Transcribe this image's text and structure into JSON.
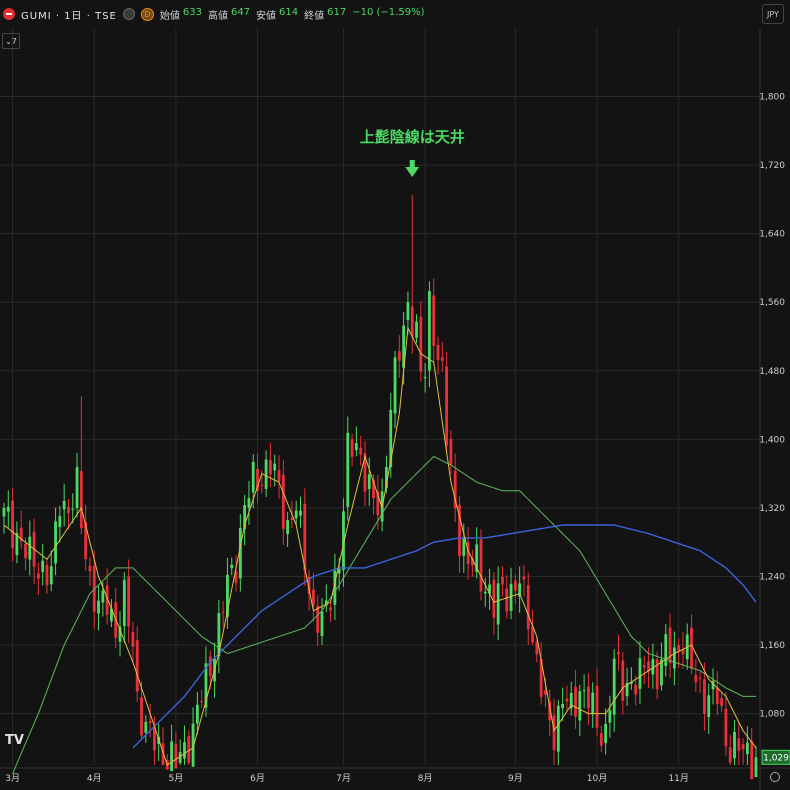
{
  "header": {
    "symbol": "GUMI · 1日 · TSE",
    "ohlc": [
      {
        "k": "始値",
        "v": "633"
      },
      {
        "k": "高値",
        "v": "647"
      },
      {
        "k": "安値",
        "v": "614"
      },
      {
        "k": "終値",
        "v": "617"
      },
      {
        "k": "",
        "v": "−10 (−1.59%)"
      }
    ],
    "currency": "JPY",
    "indicator_count": "7",
    "orange_badge": "D"
  },
  "colors": {
    "background": "#131313",
    "up": "#4cd964",
    "down": "#e8303a",
    "ma_short": "#e0c040",
    "ma_mid": "#5dbb5d",
    "ma_long": "#3a64d8",
    "annotation": "#4cd964"
  },
  "chart_data": {
    "type": "candlestick",
    "title": "",
    "annotation": "上髭陰線は天井",
    "y_ticks": [
      "1,800",
      "1,720",
      "1,640",
      "1,560",
      "1,480",
      "1,400",
      "1,320",
      "1,240",
      "1,160",
      "1,080"
    ],
    "ylim": [
      1020,
      1880
    ],
    "last_price_label": "1,029",
    "months": [
      {
        "label": "3月",
        "t": 2
      },
      {
        "label": "4月",
        "t": 21
      },
      {
        "label": "5月",
        "t": 40
      },
      {
        "label": "6月",
        "t": 59
      },
      {
        "label": "7月",
        "t": 79
      },
      {
        "label": "8月",
        "t": 98
      },
      {
        "label": "9月",
        "t": 119
      },
      {
        "label": "10月",
        "t": 138
      },
      {
        "label": "11月",
        "t": 157
      }
    ],
    "n_days": 176,
    "close_keyframes": [
      [
        0,
        1310
      ],
      [
        3,
        1290
      ],
      [
        6,
        1260
      ],
      [
        9,
        1250
      ],
      [
        11,
        1240
      ],
      [
        13,
        1330
      ],
      [
        15,
        1320
      ],
      [
        17,
        1340
      ],
      [
        18,
        1300
      ],
      [
        20,
        1240
      ],
      [
        22,
        1200
      ],
      [
        24,
        1210
      ],
      [
        26,
        1180
      ],
      [
        28,
        1210
      ],
      [
        30,
        1160
      ],
      [
        31,
        1100
      ],
      [
        33,
        1060
      ],
      [
        36,
        1040
      ],
      [
        38,
        1030
      ],
      [
        40,
        1020
      ],
      [
        42,
        1040
      ],
      [
        44,
        1060
      ],
      [
        46,
        1100
      ],
      [
        48,
        1140
      ],
      [
        50,
        1180
      ],
      [
        52,
        1230
      ],
      [
        54,
        1260
      ],
      [
        56,
        1320
      ],
      [
        58,
        1350
      ],
      [
        60,
        1360
      ],
      [
        62,
        1370
      ],
      [
        64,
        1340
      ],
      [
        66,
        1300
      ],
      [
        68,
        1320
      ],
      [
        70,
        1260
      ],
      [
        72,
        1200
      ],
      [
        74,
        1180
      ],
      [
        76,
        1220
      ],
      [
        78,
        1260
      ],
      [
        80,
        1380
      ],
      [
        82,
        1400
      ],
      [
        84,
        1360
      ],
      [
        86,
        1320
      ],
      [
        88,
        1330
      ],
      [
        90,
        1440
      ],
      [
        92,
        1500
      ],
      [
        94,
        1560
      ],
      [
        95,
        1580
      ],
      [
        96,
        1520
      ],
      [
        97,
        1470
      ],
      [
        98,
        1480
      ],
      [
        99,
        1560
      ],
      [
        100,
        1530
      ],
      [
        101,
        1500
      ],
      [
        102,
        1470
      ],
      [
        103,
        1400
      ],
      [
        104,
        1360
      ],
      [
        105,
        1320
      ],
      [
        106,
        1290
      ],
      [
        108,
        1250
      ],
      [
        110,
        1260
      ],
      [
        112,
        1230
      ],
      [
        114,
        1200
      ],
      [
        116,
        1230
      ],
      [
        118,
        1220
      ],
      [
        120,
        1230
      ],
      [
        122,
        1200
      ],
      [
        124,
        1140
      ],
      [
        126,
        1080
      ],
      [
        128,
        1060
      ],
      [
        130,
        1100
      ],
      [
        132,
        1080
      ],
      [
        134,
        1110
      ],
      [
        136,
        1100
      ],
      [
        138,
        1060
      ],
      [
        140,
        1060
      ],
      [
        142,
        1140
      ],
      [
        144,
        1110
      ],
      [
        146,
        1120
      ],
      [
        148,
        1120
      ],
      [
        150,
        1140
      ],
      [
        152,
        1130
      ],
      [
        154,
        1150
      ],
      [
        156,
        1150
      ],
      [
        158,
        1170
      ],
      [
        160,
        1130
      ],
      [
        162,
        1110
      ],
      [
        164,
        1100
      ],
      [
        166,
        1100
      ],
      [
        168,
        1050
      ],
      [
        170,
        1040
      ],
      [
        172,
        1035
      ],
      [
        174,
        1030
      ],
      [
        175,
        1029
      ]
    ],
    "ma_short": [
      [
        0,
        1300
      ],
      [
        10,
        1260
      ],
      [
        18,
        1320
      ],
      [
        22,
        1240
      ],
      [
        30,
        1140
      ],
      [
        38,
        1020
      ],
      [
        44,
        1040
      ],
      [
        50,
        1150
      ],
      [
        56,
        1300
      ],
      [
        60,
        1360
      ],
      [
        64,
        1350
      ],
      [
        68,
        1300
      ],
      [
        72,
        1200
      ],
      [
        76,
        1210
      ],
      [
        80,
        1300
      ],
      [
        84,
        1380
      ],
      [
        88,
        1320
      ],
      [
        92,
        1430
      ],
      [
        94,
        1530
      ],
      [
        97,
        1500
      ],
      [
        100,
        1490
      ],
      [
        104,
        1350
      ],
      [
        108,
        1270
      ],
      [
        114,
        1210
      ],
      [
        120,
        1220
      ],
      [
        124,
        1170
      ],
      [
        128,
        1060
      ],
      [
        132,
        1090
      ],
      [
        136,
        1080
      ],
      [
        140,
        1080
      ],
      [
        144,
        1110
      ],
      [
        150,
        1130
      ],
      [
        156,
        1150
      ],
      [
        160,
        1160
      ],
      [
        164,
        1120
      ],
      [
        168,
        1100
      ],
      [
        172,
        1060
      ],
      [
        175,
        1040
      ]
    ],
    "ma_mid": [
      [
        2,
        1010
      ],
      [
        8,
        1080
      ],
      [
        14,
        1160
      ],
      [
        20,
        1220
      ],
      [
        26,
        1250
      ],
      [
        30,
        1250
      ],
      [
        34,
        1230
      ],
      [
        40,
        1200
      ],
      [
        46,
        1170
      ],
      [
        52,
        1150
      ],
      [
        58,
        1160
      ],
      [
        64,
        1170
      ],
      [
        70,
        1180
      ],
      [
        74,
        1200
      ],
      [
        78,
        1230
      ],
      [
        84,
        1280
      ],
      [
        90,
        1330
      ],
      [
        96,
        1360
      ],
      [
        100,
        1380
      ],
      [
        104,
        1370
      ],
      [
        110,
        1350
      ],
      [
        116,
        1340
      ],
      [
        120,
        1340
      ],
      [
        124,
        1320
      ],
      [
        128,
        1300
      ],
      [
        134,
        1270
      ],
      [
        140,
        1220
      ],
      [
        146,
        1170
      ],
      [
        150,
        1150
      ],
      [
        156,
        1140
      ],
      [
        162,
        1130
      ],
      [
        168,
        1110
      ],
      [
        172,
        1100
      ],
      [
        175,
        1100
      ]
    ],
    "ma_long": [
      [
        30,
        1040
      ],
      [
        36,
        1070
      ],
      [
        42,
        1100
      ],
      [
        48,
        1140
      ],
      [
        54,
        1170
      ],
      [
        60,
        1200
      ],
      [
        66,
        1220
      ],
      [
        72,
        1240
      ],
      [
        78,
        1250
      ],
      [
        84,
        1250
      ],
      [
        90,
        1260
      ],
      [
        96,
        1270
      ],
      [
        100,
        1280
      ],
      [
        106,
        1285
      ],
      [
        112,
        1285
      ],
      [
        118,
        1290
      ],
      [
        124,
        1295
      ],
      [
        130,
        1300
      ],
      [
        136,
        1300
      ],
      [
        142,
        1300
      ],
      [
        146,
        1295
      ],
      [
        150,
        1290
      ],
      [
        156,
        1280
      ],
      [
        162,
        1270
      ],
      [
        168,
        1250
      ],
      [
        172,
        1230
      ],
      [
        175,
        1210
      ]
    ],
    "grid": true
  }
}
